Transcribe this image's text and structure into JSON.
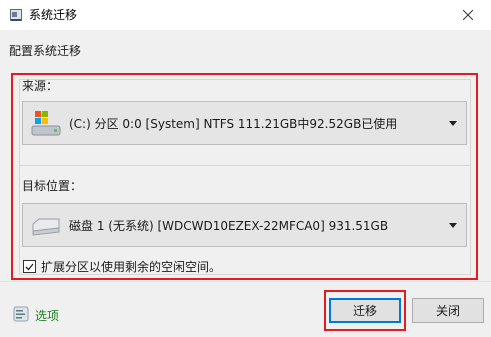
{
  "window": {
    "title": "系统迁移"
  },
  "main": {
    "section_title": "配置系统迁移",
    "source": {
      "label": "来源：",
      "value": "(C:) 分区 0:0 [System] NTFS   111.21GB中92.52GB已使用"
    },
    "destination": {
      "label": "目标位置：",
      "value": "磁盘 1  (无系统)  [WDCWD10EZEX-22MFCA0]   931.51GB"
    },
    "checkbox": {
      "label": "扩展分区以使用剩余的空闲空间。",
      "checked": true
    }
  },
  "footer": {
    "options_label": "选项",
    "migrate_button": "迁移",
    "close_button": "关闭"
  },
  "colors": {
    "highlight": "#e31b23",
    "link_green": "#1a7f1a",
    "focus_blue": "#0078d7"
  }
}
